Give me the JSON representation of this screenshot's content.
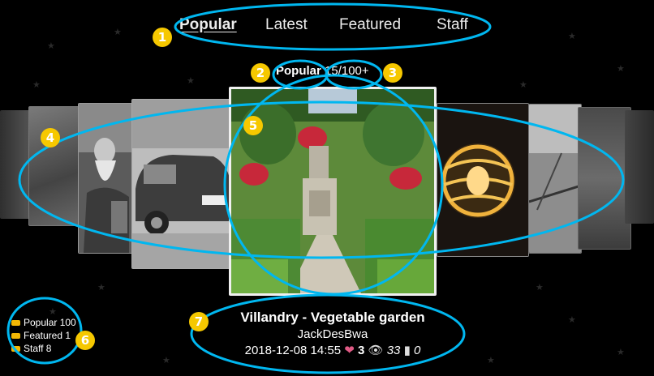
{
  "tabs": [
    {
      "label": "Popular",
      "active": true
    },
    {
      "label": "Latest",
      "active": false
    },
    {
      "label": "Featured",
      "active": false
    },
    {
      "label": "Staff",
      "active": false
    }
  ],
  "counter": {
    "category": "Popular",
    "position": "15/100+"
  },
  "photo": {
    "title": "Villandry - Vegetable garden",
    "author": "JackDesBwa",
    "date": "2018-12-08 14:55",
    "likes": "3",
    "views": "33",
    "comments": "0"
  },
  "legend": [
    {
      "label": "Popular 100"
    },
    {
      "label": "Featured 1"
    },
    {
      "label": "Staff 8"
    }
  ],
  "annotations": [
    "1",
    "2",
    "3",
    "4",
    "5",
    "6",
    "7"
  ],
  "colors": {
    "background": "#000000",
    "tag": "#f2b705",
    "heart": "#e05a85",
    "callout": "#00b7f0",
    "badge": "#f6c800"
  },
  "icons": {
    "like": "heart-icon",
    "views": "eye-icon",
    "comments": "comment-icon",
    "legend": "tag-icon"
  }
}
